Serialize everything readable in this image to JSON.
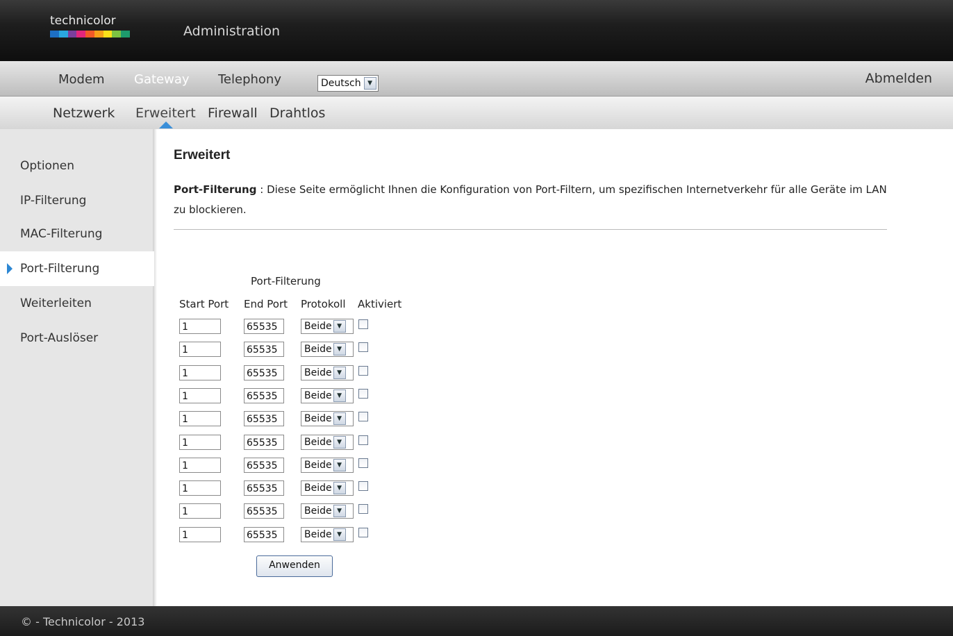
{
  "header": {
    "logo_text": "technicolor",
    "logo_colors": [
      "#1d6fc4",
      "#2aa7df",
      "#7a3f9c",
      "#e2267c",
      "#f05a28",
      "#f5a01a",
      "#fbe01a",
      "#7cc242",
      "#1d9a6c"
    ],
    "app_title": "Administration"
  },
  "nav1": {
    "items": [
      {
        "label": "Modem"
      },
      {
        "label": "Gateway"
      },
      {
        "label": "Telephony"
      }
    ],
    "active": "Gateway",
    "language": "Deutsch",
    "logout": "Abmelden"
  },
  "nav2": {
    "items": [
      {
        "label": "Netzwerk"
      },
      {
        "label": "Erweitert"
      },
      {
        "label": "Firewall"
      },
      {
        "label": "Drahtlos"
      }
    ],
    "active": "Erweitert"
  },
  "sidebar": {
    "items": [
      {
        "label": "Optionen"
      },
      {
        "label": "IP-Filterung"
      },
      {
        "label": "MAC-Filterung"
      },
      {
        "label": "Port-Filterung"
      },
      {
        "label": "Weiterleiten"
      },
      {
        "label": "Port-Auslöser"
      }
    ],
    "active": "Port-Filterung"
  },
  "main": {
    "title": "Erweitert",
    "desc_bold": "Port-Filterung",
    "desc_sep": " : ",
    "desc_text": " Diese Seite ermöglicht Ihnen die Konfiguration von Port-Filtern, um spezifischen Internetverkehr für alle Geräte im LAN zu blockieren."
  },
  "table": {
    "caption": "Port-Filterung",
    "headers": {
      "start": "Start Port",
      "end": "End Port",
      "protocol": "Protokoll",
      "enabled": "Aktiviert"
    },
    "rows": [
      {
        "start": "1",
        "end": "65535",
        "protocol": "Beide",
        "enabled": false
      },
      {
        "start": "1",
        "end": "65535",
        "protocol": "Beide",
        "enabled": false
      },
      {
        "start": "1",
        "end": "65535",
        "protocol": "Beide",
        "enabled": false
      },
      {
        "start": "1",
        "end": "65535",
        "protocol": "Beide",
        "enabled": false
      },
      {
        "start": "1",
        "end": "65535",
        "protocol": "Beide",
        "enabled": false
      },
      {
        "start": "1",
        "end": "65535",
        "protocol": "Beide",
        "enabled": false
      },
      {
        "start": "1",
        "end": "65535",
        "protocol": "Beide",
        "enabled": false
      },
      {
        "start": "1",
        "end": "65535",
        "protocol": "Beide",
        "enabled": false
      },
      {
        "start": "1",
        "end": "65535",
        "protocol": "Beide",
        "enabled": false
      },
      {
        "start": "1",
        "end": "65535",
        "protocol": "Beide",
        "enabled": false
      }
    ],
    "apply_label": "Anwenden"
  },
  "footer": {
    "text": "© - Technicolor - 2013"
  },
  "colors": {
    "accent": "#2d87d3",
    "header_bg": "#1e1e1e",
    "sidebar_bg": "#e6e6e6"
  }
}
